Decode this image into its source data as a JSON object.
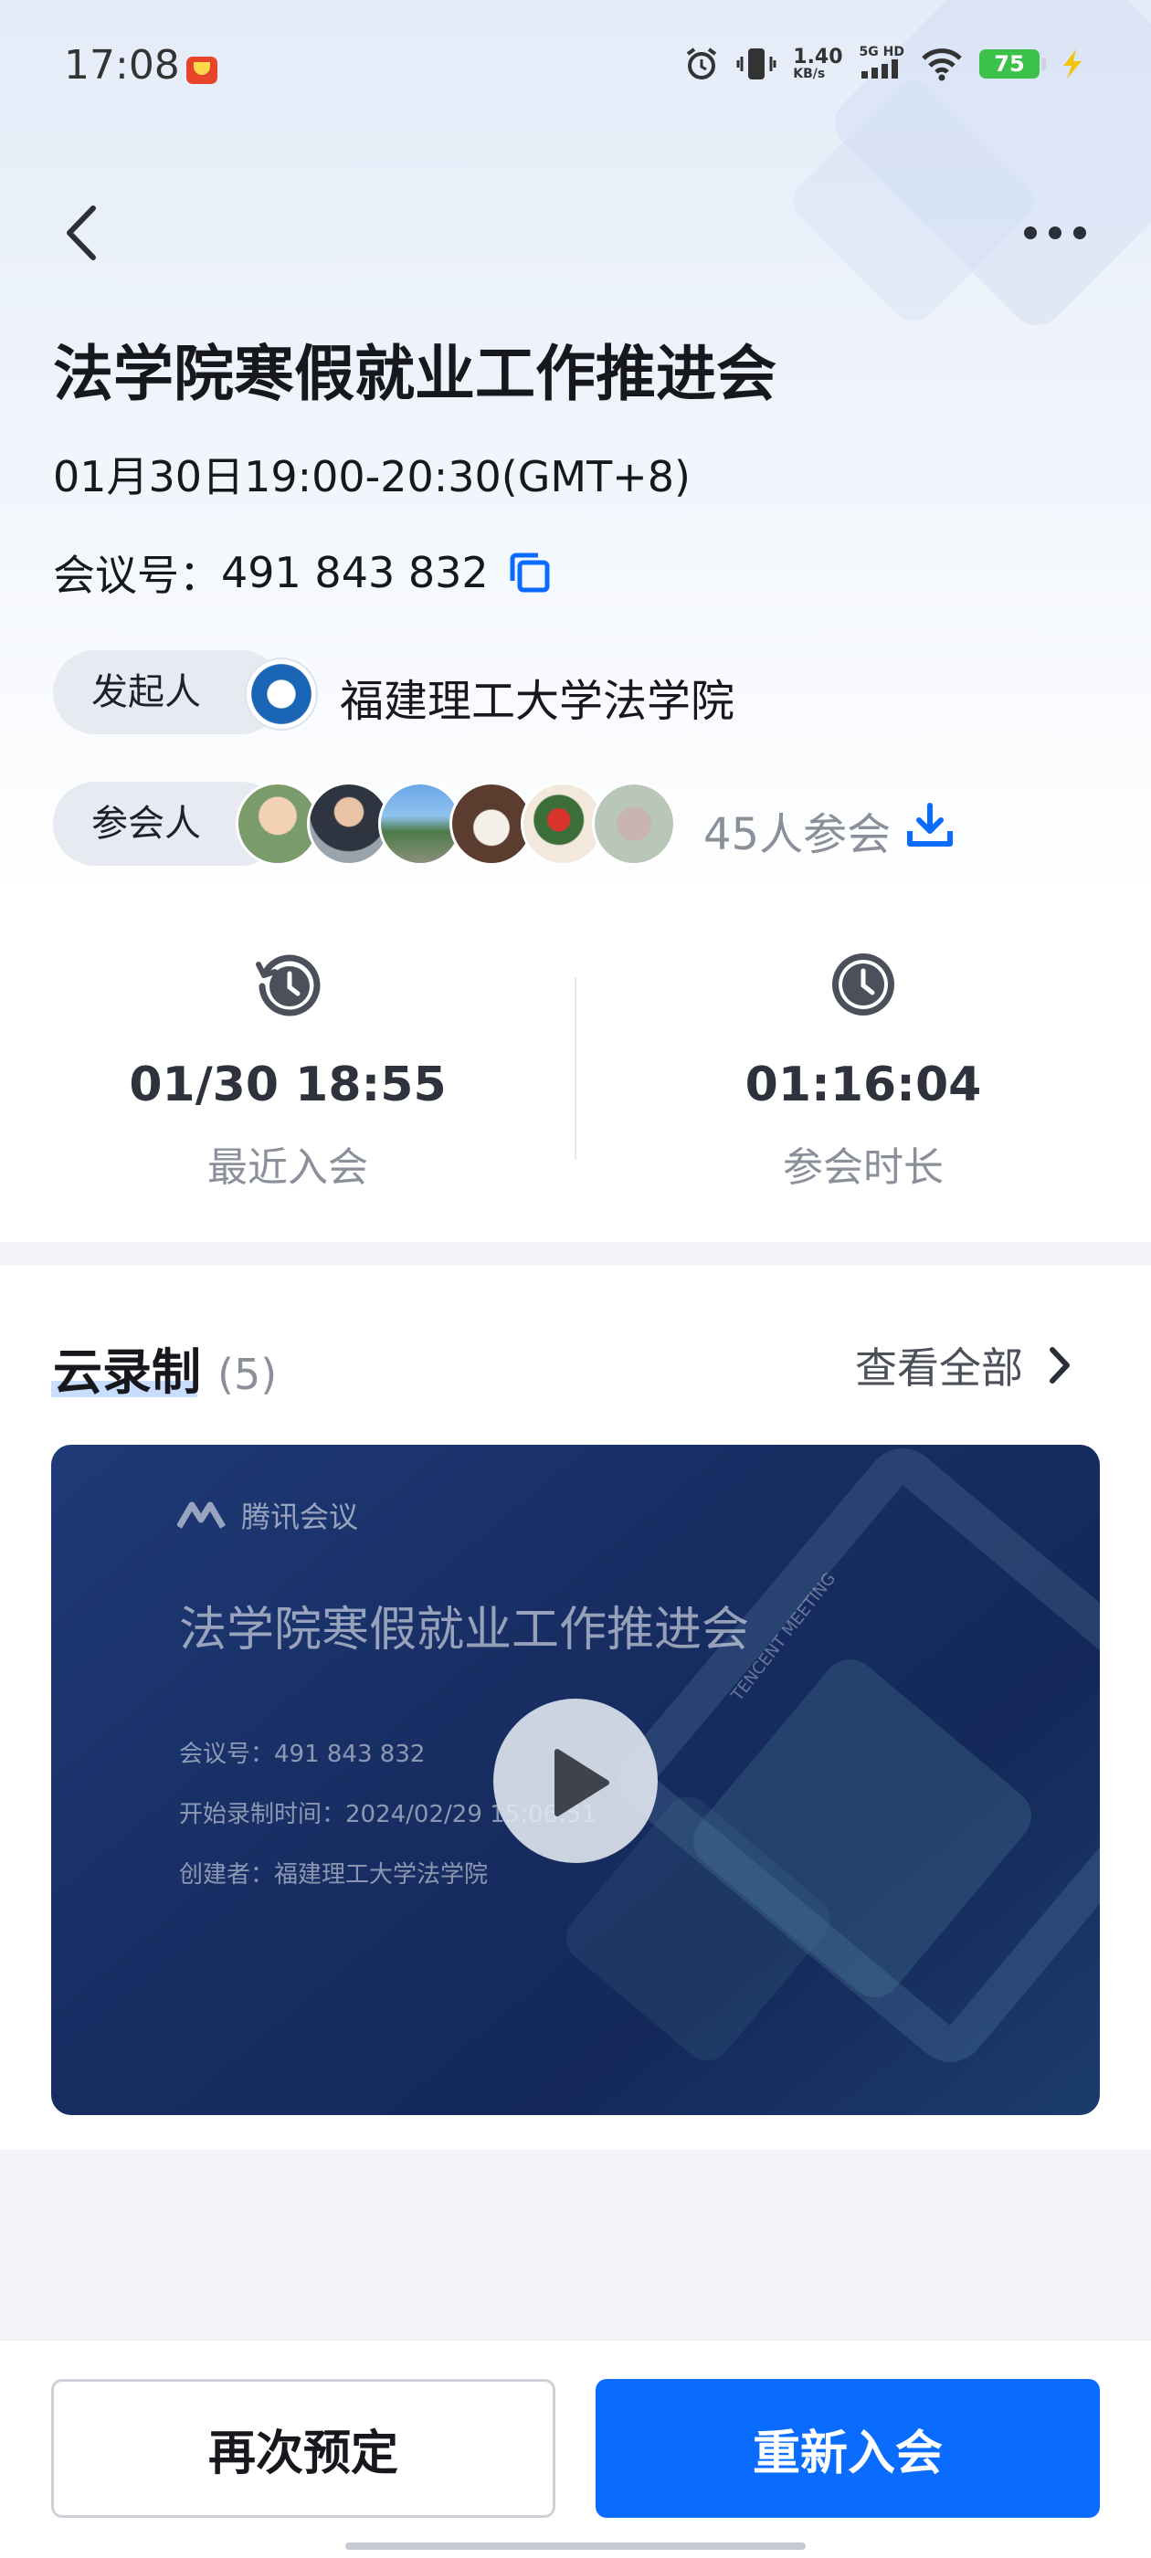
{
  "status_bar": {
    "time": "17:08",
    "net_speed_value": "1.40",
    "net_speed_unit": "KB/s",
    "network_label": "5G HD",
    "battery_level": "75",
    "icons": [
      "alarm-icon",
      "vibrate-icon",
      "signal-icon",
      "wifi-icon",
      "battery-icon",
      "charging-icon"
    ]
  },
  "nav": {
    "back_icon": "chevron-left-icon",
    "more_icon": "more-dots-icon"
  },
  "meeting": {
    "title": "法学院寒假就业工作推进会",
    "time_range": "01月30日19:00-20:30(GMT+8)",
    "id_label": "会议号：",
    "id_value": "491 843 832",
    "organizer_label": "发起人",
    "organizer_name": "福建理工大学法学院",
    "participants_label": "参会人",
    "participants_count": "45人参会"
  },
  "stats": {
    "recent_join_value": "01/30 18:55",
    "recent_join_label": "最近入会",
    "duration_value": "01:16:04",
    "duration_label": "参会时长"
  },
  "recording": {
    "title": "云录制",
    "count": "(5)",
    "view_all": "查看全部",
    "card": {
      "brand": "腾讯会议",
      "title": "法学院寒假就业工作推进会",
      "meeting_id_line": "会议号：491 843 832",
      "start_time_line": "开始录制时间：2024/02/29 15:06:51",
      "creator_line": "创建者：福建理工大学法学院",
      "watermark": "TENCENT MEETING"
    }
  },
  "actions": {
    "rebook": "再次预定",
    "rejoin": "重新入会"
  },
  "colors": {
    "accent": "#0a6cff",
    "video_bg": "#1b3367"
  }
}
